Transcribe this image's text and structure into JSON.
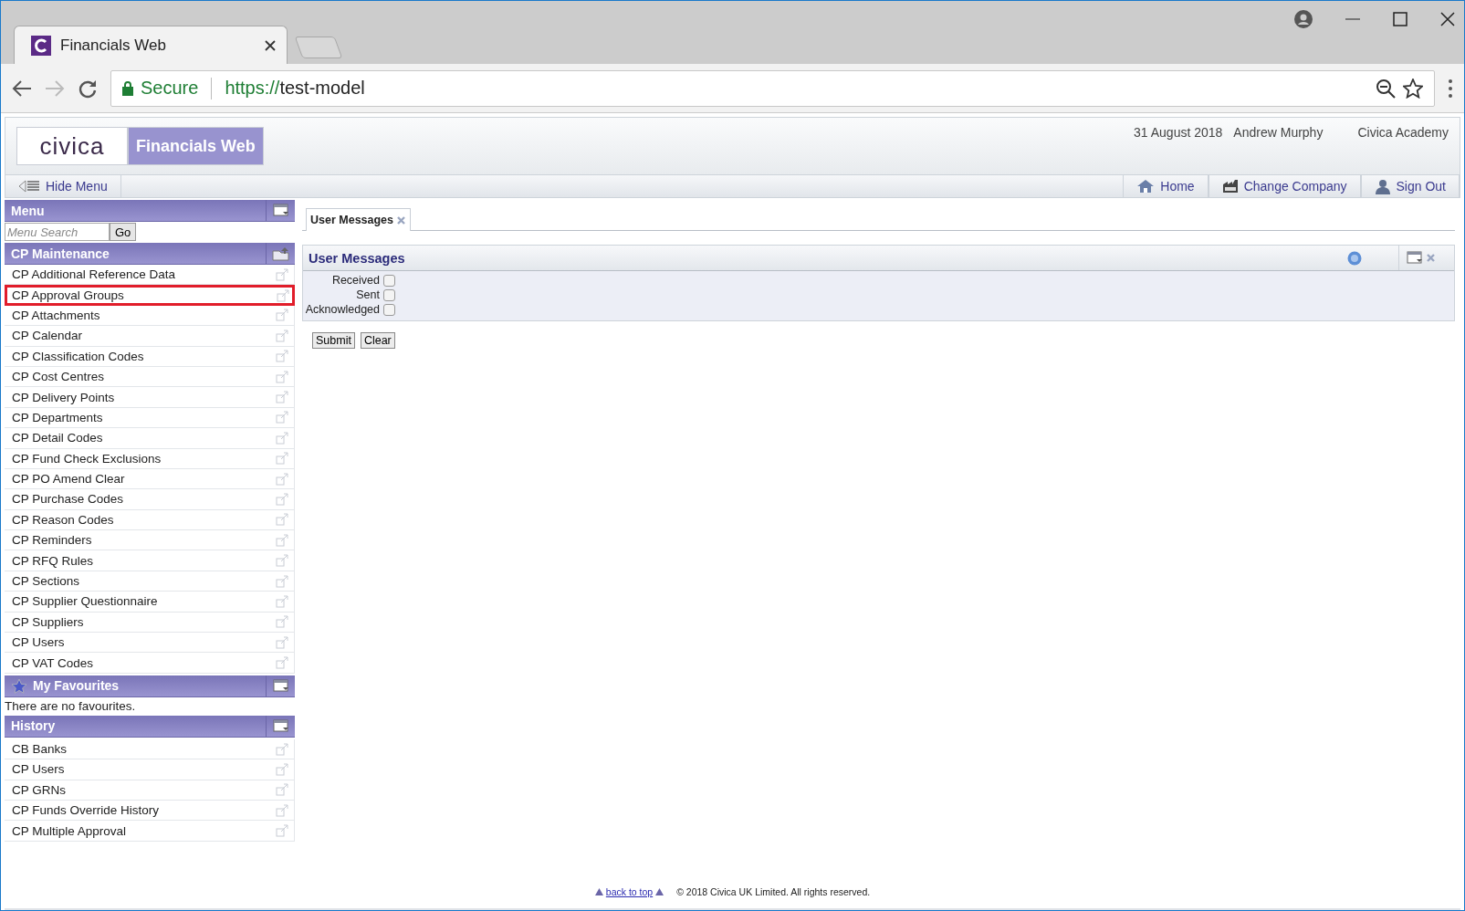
{
  "browser": {
    "tab_title": "Financials Web",
    "secure_label": "Secure",
    "url_scheme": "https://",
    "url_host": "test-model"
  },
  "header": {
    "logo": "civica",
    "app_name": "Financials Web",
    "date": "31 August 2018",
    "user": "Andrew Murphy",
    "company": "Civica Academy"
  },
  "toolbar": {
    "hide_menu": "Hide Menu",
    "links": [
      {
        "kind": "home",
        "label": "Home"
      },
      {
        "kind": "company",
        "label": "Change Company"
      },
      {
        "kind": "signout",
        "label": "Sign Out"
      }
    ]
  },
  "menu": {
    "title": "Menu",
    "search_placeholder": "Menu Search",
    "go": "Go"
  },
  "cp_maintenance": {
    "title": "CP Maintenance",
    "items": [
      {
        "label": "CP Additional Reference Data",
        "highlighted": false
      },
      {
        "label": "CP Approval Groups",
        "highlighted": true
      },
      {
        "label": "CP Attachments",
        "highlighted": false
      },
      {
        "label": "CP Calendar",
        "highlighted": false
      },
      {
        "label": "CP Classification Codes",
        "highlighted": false
      },
      {
        "label": "CP Cost Centres",
        "highlighted": false
      },
      {
        "label": "CP Delivery Points",
        "highlighted": false
      },
      {
        "label": "CP Departments",
        "highlighted": false
      },
      {
        "label": "CP Detail Codes",
        "highlighted": false
      },
      {
        "label": "CP Fund Check Exclusions",
        "highlighted": false
      },
      {
        "label": "CP PO Amend Clear",
        "highlighted": false
      },
      {
        "label": "CP Purchase Codes",
        "highlighted": false
      },
      {
        "label": "CP Reason Codes",
        "highlighted": false
      },
      {
        "label": "CP Reminders",
        "highlighted": false
      },
      {
        "label": "CP RFQ Rules",
        "highlighted": false
      },
      {
        "label": "CP Sections",
        "highlighted": false
      },
      {
        "label": "CP Supplier Questionnaire",
        "highlighted": false
      },
      {
        "label": "CP Suppliers",
        "highlighted": false
      },
      {
        "label": "CP Users",
        "highlighted": false
      },
      {
        "label": "CP VAT Codes",
        "highlighted": false
      }
    ]
  },
  "favourites": {
    "title": "My Favourites",
    "empty_text": "There are no favourites."
  },
  "history": {
    "title": "History",
    "items": [
      {
        "label": "CB Banks",
        "highlighted": false
      },
      {
        "label": "CP Users",
        "highlighted": false
      },
      {
        "label": "CP GRNs",
        "highlighted": false
      },
      {
        "label": "CP Funds Override History",
        "highlighted": false
      },
      {
        "label": "CP Multiple Approval",
        "highlighted": false
      }
    ]
  },
  "content_tabs": [
    {
      "label": "User Messages",
      "selected": true
    }
  ],
  "panel": {
    "title": "User Messages",
    "filters": [
      {
        "label": "Received",
        "checked": false
      },
      {
        "label": "Sent",
        "checked": false
      },
      {
        "label": "Acknowledged",
        "checked": false
      }
    ],
    "buttons": [
      "Submit",
      "Clear"
    ]
  },
  "footer": {
    "back_to_top": "back to top",
    "copyright": "© 2018 Civica UK Limited. All rights reserved."
  }
}
